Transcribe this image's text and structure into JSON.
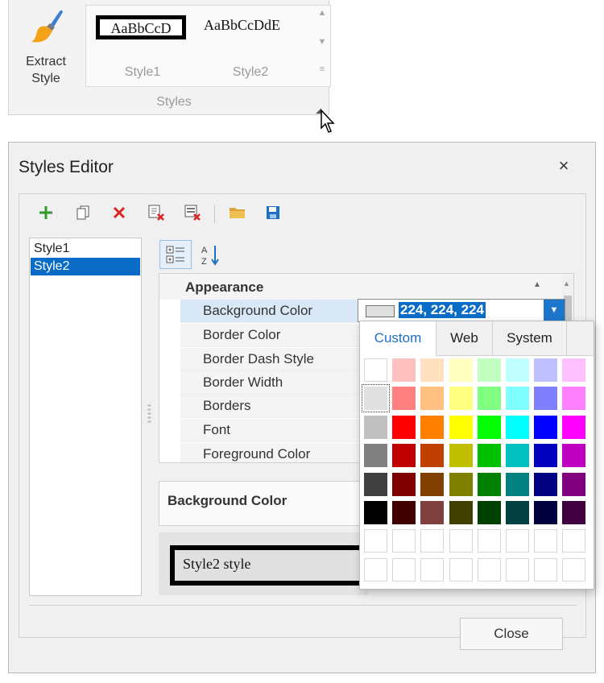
{
  "ribbon": {
    "extract_label": "Extract Style",
    "group_label": "Styles",
    "gallery": [
      {
        "sample": "AaBbCcD",
        "name": "Style1"
      },
      {
        "sample": "AaBbCcDdE",
        "name": "Style2"
      }
    ]
  },
  "dialog": {
    "title": "Styles Editor",
    "close_glyph": "×",
    "toolbar": [
      "add-icon",
      "copy-icon",
      "delete-icon",
      "purge-icon",
      "clear-icon",
      "open-icon",
      "save-icon"
    ],
    "styles": [
      "Style1",
      "Style2"
    ],
    "selected_style": "Style2",
    "category": "Appearance",
    "properties": [
      "Background Color",
      "Border Color",
      "Border Dash Style",
      "Border Width",
      "Borders",
      "Font",
      "Foreground Color"
    ],
    "selected_property": "Background Color",
    "value_text": "224, 224, 224",
    "value_color": "#e0e0e0",
    "description_title": "Background Color",
    "preview_text": "Style2 style",
    "close_button": "Close"
  },
  "color_popup": {
    "tabs": [
      "Custom",
      "Web",
      "System"
    ],
    "active_tab": "Custom",
    "palette": [
      [
        "#ffffff",
        "#ffc0c0",
        "#ffe0c0",
        "#ffffc0",
        "#c0ffc0",
        "#c0ffff",
        "#c0c0ff",
        "#ffc0ff"
      ],
      [
        "#e0e0e0",
        "#ff8080",
        "#ffc080",
        "#ffff80",
        "#80ff80",
        "#80ffff",
        "#8080ff",
        "#ff80ff"
      ],
      [
        "#c0c0c0",
        "#ff0000",
        "#ff8000",
        "#ffff00",
        "#00ff00",
        "#00ffff",
        "#0000ff",
        "#ff00ff"
      ],
      [
        "#808080",
        "#c00000",
        "#c04000",
        "#c0c000",
        "#00c000",
        "#00c0c0",
        "#0000c0",
        "#c000c0"
      ],
      [
        "#404040",
        "#800000",
        "#804000",
        "#808000",
        "#008000",
        "#008080",
        "#000080",
        "#800080"
      ],
      [
        "#000000",
        "#400000",
        "#804040",
        "#404000",
        "#004000",
        "#004040",
        "#000040",
        "#400040"
      ]
    ],
    "empty_rows": 2,
    "selected_color": "#e0e0e0"
  }
}
